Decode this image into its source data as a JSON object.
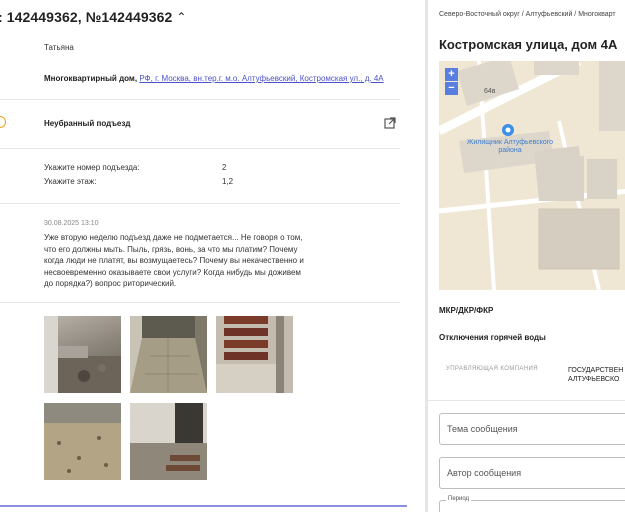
{
  "left": {
    "title": ": 142449362, №142449362",
    "author_name": "Татьяна",
    "address_label": "Многоквартирный дом,",
    "address_link": "РФ, г. Москва, вн.тер.г. м.о. Алтуфьевский, Костромская ул., д. 4А",
    "category": "Неубранный подъезд",
    "fields": [
      {
        "label": "Укажите номер подъезда:",
        "value": "2"
      },
      {
        "label": "Укажите этаж:",
        "value": "1,2"
      }
    ],
    "comment_date": "30.08.2025 13:10",
    "comment_text": "Уже вторую неделю подъезд даже не подметается... Не говоря о том, что его должны мыть. Пыль, грязь, вонь, за что мы платим? Почему когда люди не платят, вы возмущаетесь? Почему вы некачественно и несвоевременно оказываете свои услуги? Когда нибудь мы доживем до порядка?) вопрос риторический."
  },
  "right": {
    "breadcrumb": "Северо-Восточный округ / Алтуфьевский / Многокварт",
    "title": "Костромская улица, дом 4А",
    "map": {
      "zoom_in": "+",
      "zoom_out": "−",
      "building_number": "64в",
      "poi_label": "Жилищник Алтуфьевского района"
    },
    "mkr_label": "МКР/ДКР/ФКР",
    "hot_water_label": "Отключения горячей воды",
    "table_header": "УПРАВЛЯЮЩАЯ КОМПАНИЯ",
    "table_value_line1": "ГОСУДАРСТВЕН",
    "table_value_line2": "АЛТУФЬЕВСКО",
    "field_subject": "Тема сообщения",
    "field_author": "Автор сообщения",
    "period_label": "Период"
  },
  "colors": {
    "link": "#4a52c8",
    "status_dot": "#f0a020",
    "zoom_button": "#5a7de0",
    "map_bg": "#efe6d4",
    "bottom_accent": "#8c8ee0"
  }
}
